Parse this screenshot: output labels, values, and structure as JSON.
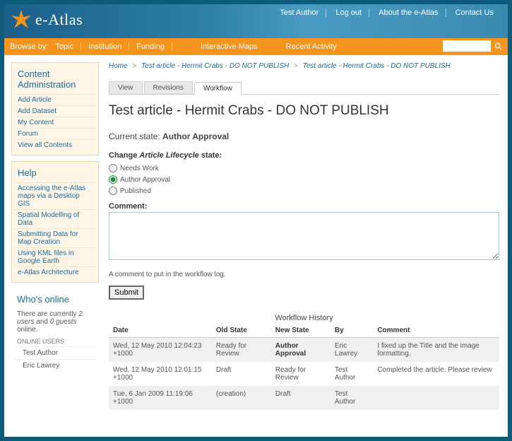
{
  "site_title": "e-Atlas",
  "top_links": [
    "Test Author",
    "Log out",
    "About the e-Atlas",
    "Contact Us"
  ],
  "nav": {
    "browse_by": "Browse by:",
    "items": [
      "Topic",
      "Institution",
      "Funding"
    ],
    "interactive_maps": "Interactive Maps",
    "recent_activity": "Recent Activity"
  },
  "sidebar": {
    "admin": {
      "title": "Content Administration",
      "links": [
        "Add Article",
        "Add Dataset",
        "My Content",
        "Forum",
        "View all Contents"
      ]
    },
    "help": {
      "title": "Help",
      "links": [
        "Accessing the e-Atlas maps via a Desktop GIS",
        "Spatial Modelling of Data",
        "Submitting Data for Map Creation",
        "Using KML files in Google Earth",
        "e-Atlas Architecture"
      ]
    },
    "online": {
      "title": "Who's online",
      "text_prefix": "There are currently ",
      "users": "2 users",
      "mid": " and ",
      "guests": "0 guests",
      "suffix": " online.",
      "label": "ONLINE USERS",
      "list": [
        "Test Author",
        "Eric Lawrey"
      ]
    }
  },
  "breadcrumb": {
    "home": "Home",
    "a": "Test article - Hermit Crabs - DO NOT PUBLISH",
    "b": "Test article - Hermit Crabs - DO NOT PUBLISH"
  },
  "tabs": [
    "View",
    "Revisions",
    "Workflow"
  ],
  "active_tab": 2,
  "page_title": "Test article - Hermit Crabs - DO NOT PUBLISH",
  "current_state_label": "Current state:",
  "current_state_value": "Author Approval",
  "change_label_pre": "Change ",
  "change_label_it": "Article Lifecycle",
  "change_label_post": " state:",
  "radios": [
    "Needs Work",
    "Author Approval",
    "Published"
  ],
  "radio_checked": 1,
  "comment_label": "Comment:",
  "hint": "A comment to put in the workflow log.",
  "submit": "Submit",
  "workflow_history_title": "Workflow History",
  "table": {
    "headers": [
      "Date",
      "Old State",
      "New State",
      "By",
      "Comment"
    ],
    "rows": [
      {
        "date": "Wed, 12 May 2010 12:04:23 +1000",
        "old": "Ready for Review",
        "new": "Author Approval",
        "by": "Eric Lawrey",
        "comment": "I fixed up the Title and the image formatting.",
        "bold_new": true
      },
      {
        "date": "Wed, 12 May 2010 12:01:15 +1000",
        "old": "Draft",
        "new": "Ready for Review",
        "by": "Test Author",
        "comment": "Completed the article. Please review"
      },
      {
        "date": "Tue, 6 Jan 2009 11:19:06 +1000",
        "old": "(creation)",
        "new": "Draft",
        "by": "Test Author",
        "comment": ""
      }
    ]
  }
}
